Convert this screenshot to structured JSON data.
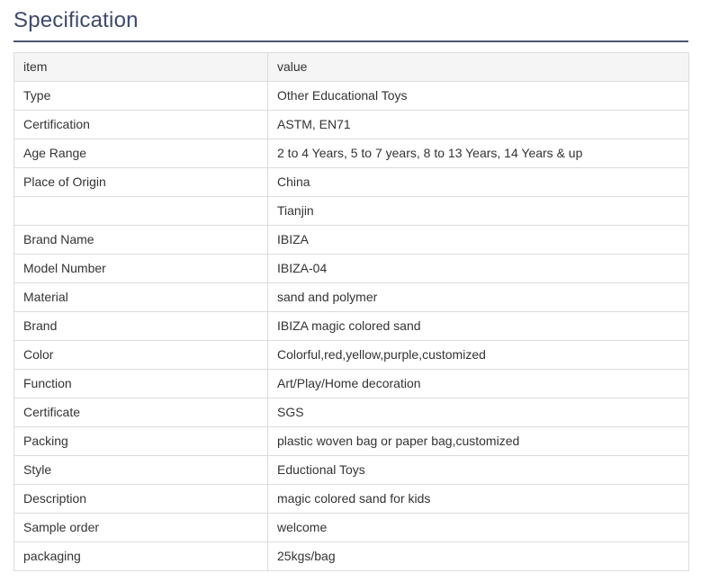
{
  "section": {
    "title": "Specification"
  },
  "table": {
    "header": {
      "item": "item",
      "value": "value"
    },
    "rows": [
      {
        "item": "Type",
        "value": "Other Educational Toys"
      },
      {
        "item": "Certification",
        "value": "ASTM, EN71"
      },
      {
        "item": "Age Range",
        "value": "2 to 4 Years, 5 to 7 years, 8 to 13 Years, 14 Years & up"
      },
      {
        "item": "Place of Origin",
        "value": "China"
      },
      {
        "item": "",
        "value": "Tianjin"
      },
      {
        "item": "Brand Name",
        "value": "IBIZA"
      },
      {
        "item": "Model Number",
        "value": "IBIZA-04"
      },
      {
        "item": "Material",
        "value": "sand and polymer"
      },
      {
        "item": "Brand",
        "value": "IBIZA magic colored sand"
      },
      {
        "item": "Color",
        "value": "Colorful,red,yellow,purple,customized"
      },
      {
        "item": "Function",
        "value": "Art/Play/Home decoration"
      },
      {
        "item": "Certificate",
        "value": "SGS"
      },
      {
        "item": "Packing",
        "value": "plastic woven bag or paper bag,customized"
      },
      {
        "item": "Style",
        "value": "Eductional Toys"
      },
      {
        "item": "Description",
        "value": "magic colored sand for kids"
      },
      {
        "item": "Sample order",
        "value": "welcome"
      },
      {
        "item": "packaging",
        "value": "25kgs/bag"
      }
    ]
  },
  "colors": {
    "title": "#3d4a6b",
    "rule": "#4a5670",
    "border": "#dcdcdc",
    "header_bg": "#f5f5f5",
    "text": "#333333"
  }
}
